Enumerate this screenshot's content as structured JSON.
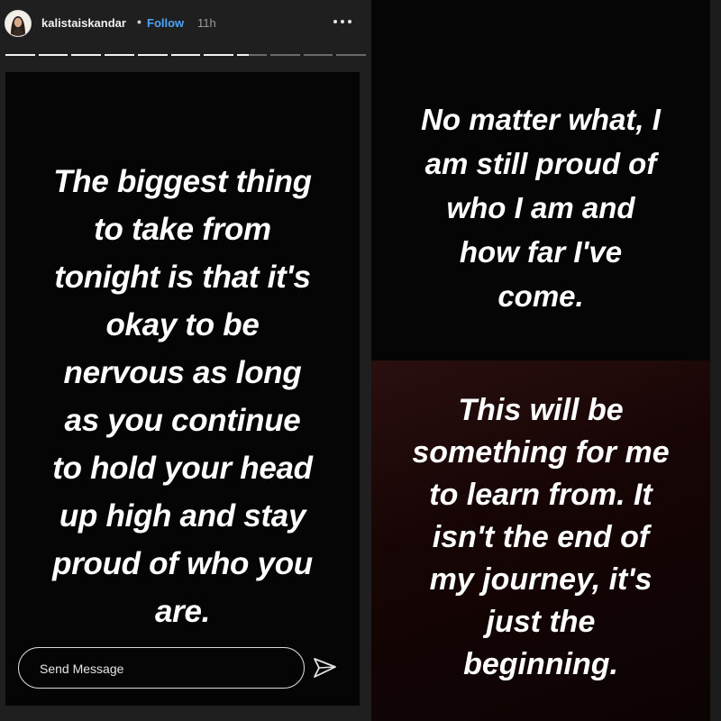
{
  "header": {
    "username": "kalistaiskandar",
    "separator": "•",
    "follow_label": "Follow",
    "time_ago": "11h",
    "more_icon": "more-horizontal-icon"
  },
  "progress": {
    "segments_total": 11,
    "segments_viewed": 7,
    "current_segment_fraction": 0.4
  },
  "story_left": {
    "lines": [
      "The biggest thing",
      "to take from",
      "tonight is that it's",
      "okay to be",
      "nervous as long",
      "as you continue",
      "to hold your head",
      "up high and stay",
      "proud of who you",
      "are."
    ]
  },
  "story_right_top": {
    "lines": [
      "No matter what, I",
      "am still proud of",
      "who I am and",
      "how far I've",
      "come."
    ]
  },
  "story_right_bottom": {
    "lines": [
      "This will be",
      "something for me",
      "to learn from. It",
      "isn't the end of",
      "my journey, it's",
      "just the",
      "beginning."
    ]
  },
  "reply": {
    "placeholder": "Send Message",
    "send_icon": "send-icon"
  },
  "colors": {
    "follow": "#4fa3f7",
    "story_background": "#050505",
    "bottom_background": "#1a0707"
  }
}
